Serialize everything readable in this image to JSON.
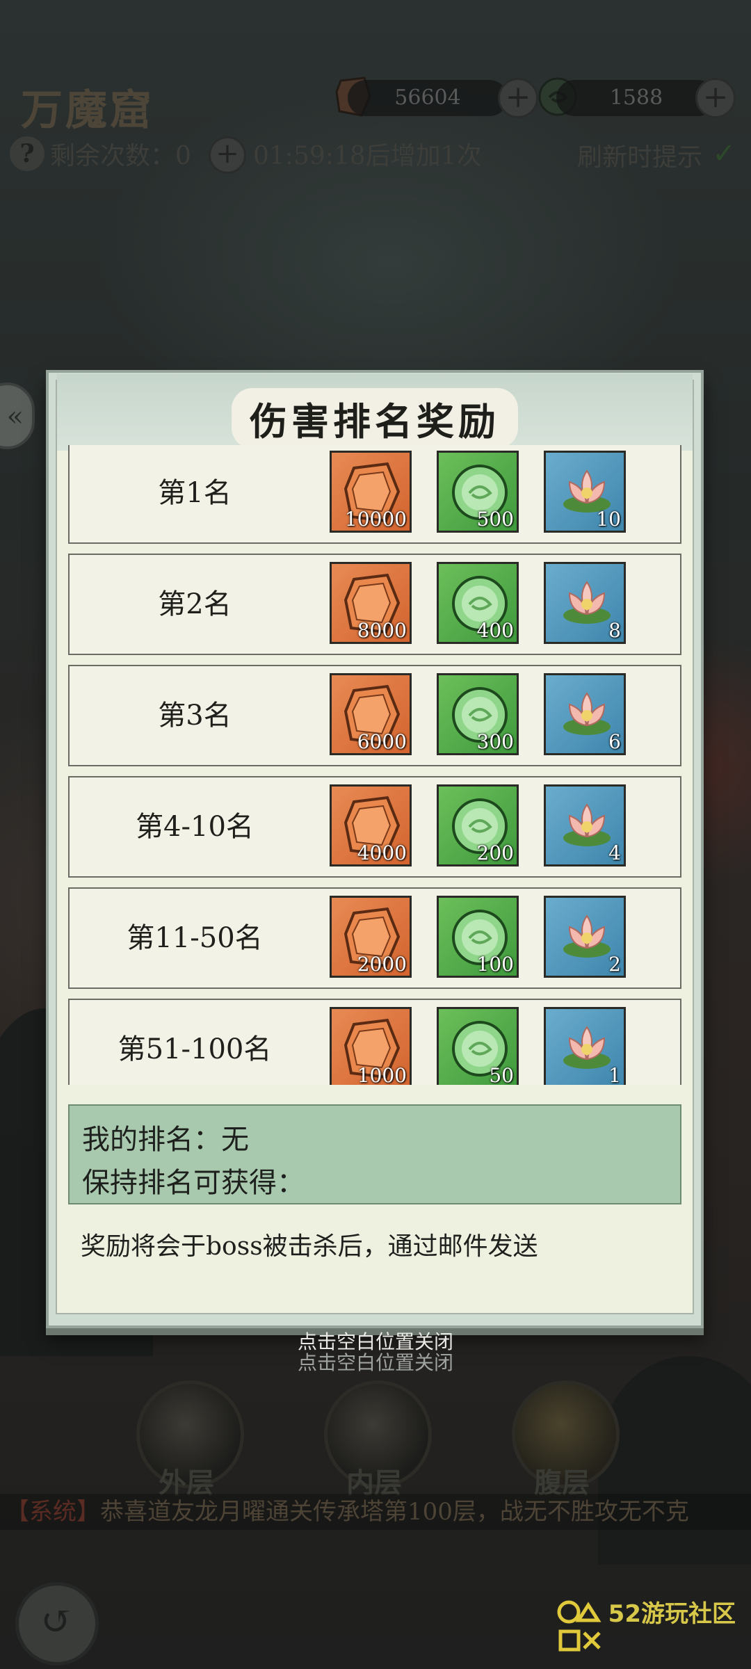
{
  "header": {
    "title": "万魔窟",
    "resource1": "56604",
    "resource2": "1588",
    "remaining_label": "剩余次数：0",
    "timer_text": "01:59:18后增加1次",
    "refresh_tip": "刷新时提示"
  },
  "modal": {
    "title": "伤害排名奖励",
    "rows": [
      {
        "rank": "第1名",
        "jade": "10000",
        "orb": "500",
        "lotus": "10"
      },
      {
        "rank": "第2名",
        "jade": "8000",
        "orb": "400",
        "lotus": "8"
      },
      {
        "rank": "第3名",
        "jade": "6000",
        "orb": "300",
        "lotus": "6"
      },
      {
        "rank": "第4-10名",
        "jade": "4000",
        "orb": "200",
        "lotus": "4"
      },
      {
        "rank": "第11-50名",
        "jade": "2000",
        "orb": "100",
        "lotus": "2"
      },
      {
        "rank": "第51-100名",
        "jade": "1000",
        "orb": "50",
        "lotus": "1"
      }
    ],
    "my_rank": "我的排名：无",
    "keep_rank": "保持排名可获得：",
    "notice": "奖励将会于boss被击杀后，通过邮件发送"
  },
  "close_hint": "点击空白位置关闭",
  "bottom_nav": {
    "outer": "外层",
    "inner": "内层",
    "core": "腹层"
  },
  "system_msg": {
    "tag": "【系统】",
    "text": "恭喜道友龙月曜通关传承塔第100层，战无不胜攻无不克"
  },
  "watermark": {
    "main": "52游玩社区"
  },
  "colors": {
    "jade_bg": "#d3642f",
    "orb_bg": "#3f9a3d",
    "lotus_bg": "#3f86ad",
    "panel_green": "#a9c9ae"
  }
}
